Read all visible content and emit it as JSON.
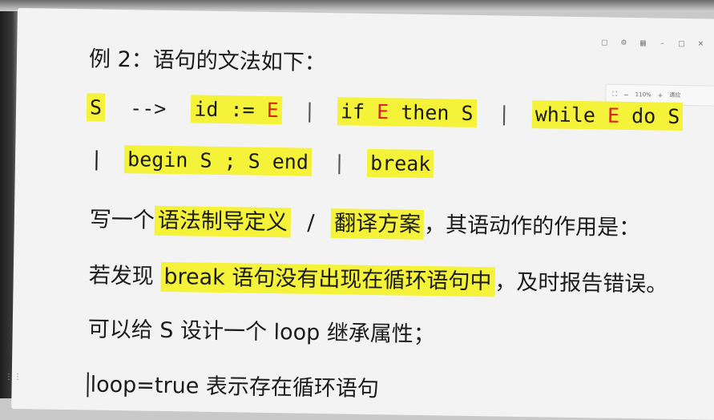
{
  "zoom": {
    "value": "110%",
    "minus": "−",
    "plus": "+",
    "fit_label": "適应"
  },
  "title": "例 2：语句的文法如下：",
  "grammar": {
    "lhs": "S",
    "arrow": "-->",
    "p1_a": "id :=",
    "p1_e": "E",
    "bar": "|",
    "p2_if": "if",
    "p2_e": "E",
    "p2_rest": "then S",
    "p3_while": "while",
    "p3_e": "E",
    "p3_rest": "do S",
    "p4": "begin S ; S end",
    "p5": "break"
  },
  "line_write": {
    "pre": "写一个",
    "hl1": "语法制导定义",
    "slash": "/",
    "hl2": "翻译方案",
    "post": "，其语动作的作用是："
  },
  "line_if": {
    "pre": "若发现",
    "hl": "break 语句没有出现在循环语句中",
    "post": "，及时报告错误。"
  },
  "line_attr": "可以给 S 设计一个 loop 继承属性；",
  "line_loop": "loop=true 表示存在循环语句",
  "colors": {
    "highlight": "#f5f23a",
    "error_e": "#d6261b"
  },
  "icons": [
    "grip-icon",
    "fullscreen-icon",
    "minimize-icon",
    "close-icon",
    "fit-icon"
  ]
}
